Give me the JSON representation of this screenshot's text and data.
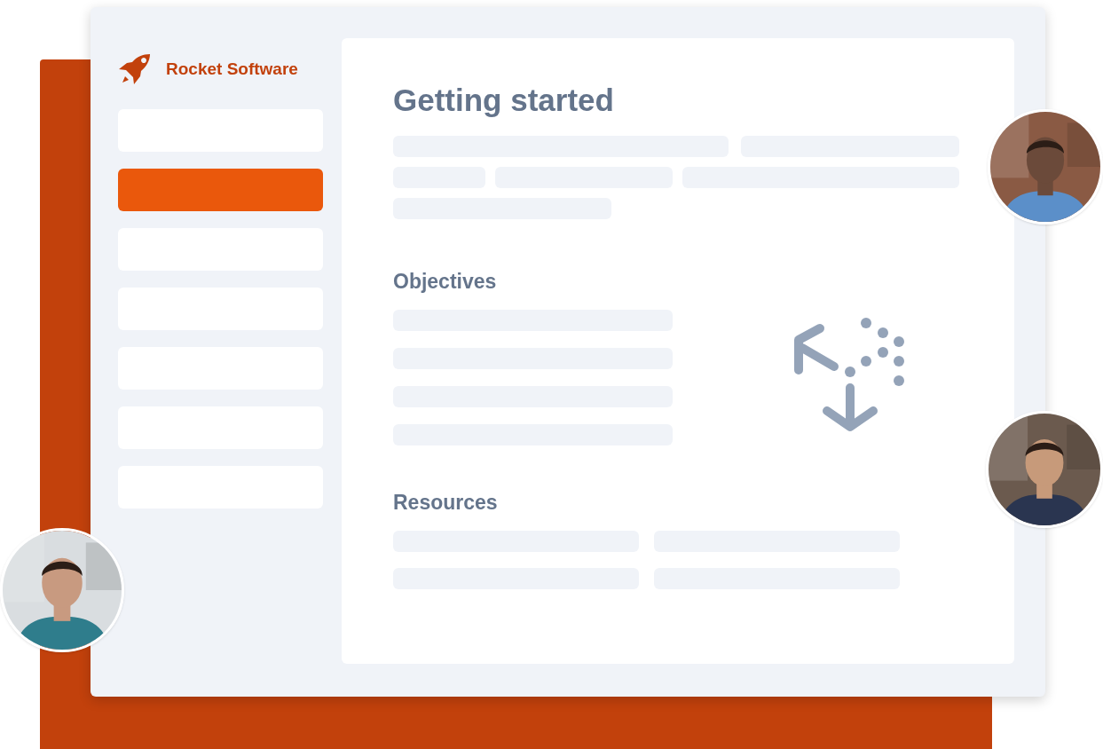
{
  "brand": {
    "name": "Rocket Software"
  },
  "sidebar": {
    "items": [
      {
        "selected": false
      },
      {
        "selected": true
      },
      {
        "selected": false
      },
      {
        "selected": false
      },
      {
        "selected": false
      },
      {
        "selected": false
      },
      {
        "selected": false
      }
    ]
  },
  "content": {
    "title": "Getting started",
    "sections": [
      {
        "kind": "objectives",
        "heading": "Objectives"
      },
      {
        "kind": "resources",
        "heading": "Resources"
      }
    ]
  }
}
